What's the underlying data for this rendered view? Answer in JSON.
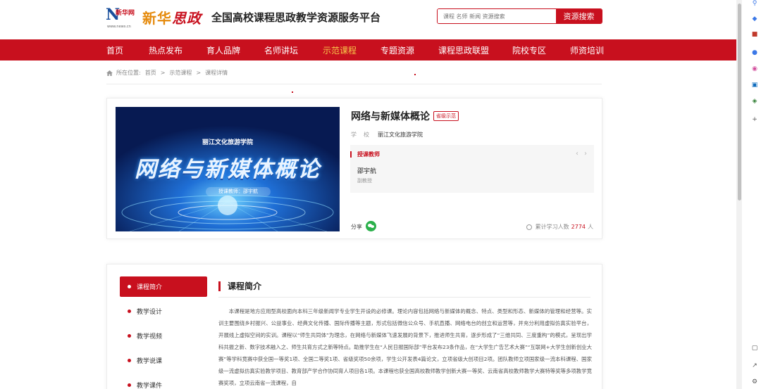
{
  "header": {
    "logo_n": "N",
    "logo_xhw": "新华网",
    "logo_url": "www.news.cn",
    "logo_brand_1": "新华",
    "logo_brand_2": "思政",
    "site_title": "全国高校课程思政教学资源服务平台",
    "search_placeholder": "课程 名师 新闻 资源搜索",
    "search_button": "资源搜索"
  },
  "nav": {
    "items": [
      "首页",
      "热点发布",
      "育人品牌",
      "名师讲坛",
      "示范课程",
      "专题资源",
      "课程思政联盟",
      "院校专区",
      "师资培训"
    ],
    "active": "示范课程"
  },
  "breadcrumb": {
    "prefix": "所在位置:",
    "items": [
      "首页",
      ">",
      "示范课程",
      ">",
      "课程详情"
    ]
  },
  "course": {
    "cover_school": "丽江文化旅游学院",
    "cover_title": "网络与新媒体概论",
    "cover_teacher": "授课教师：邵宇航",
    "title": "网络与新媒体概论",
    "level_badge": "省级示范",
    "school_label": "学校",
    "school_value": "丽江文化旅游学院",
    "teacher_box_title": "授课教师",
    "teacher_name": "邵宇航",
    "teacher_title": "副教授",
    "share_label": "分享",
    "learners_label": "累计学习人数",
    "learners_count": "2774",
    "learners_unit": "人"
  },
  "detail": {
    "menu": [
      "课程简介",
      "教学设计",
      "教学视频",
      "教学说课",
      "教学课件"
    ],
    "active_menu": "课程简介",
    "section_title": "课程简介",
    "section_text": "本课程是地方应用型高校面向本科三年级新闻学专业学生开设的必修课。理论内容包括网络与新媒体的概念、特点、类型和形态、新媒体的管理和经营等。实训主要围绕乡村振兴、公益事业、经典文化传播、国际传播等主题，形式包括微信公众号、手机直播、网络电台的创立和运营等，并充分利用虚拟仿真实验平台，开展线上虚拟空间的实训。课程以“师生共同体”为理念，在网络与新媒体飞速发展的背景下，推进师生共育，逐步形成了“三维共同、三度重构”的模式，呈现出学科共振之新、数字技术融入之、师生共育方式之新等特点。助推学生在“人民日报国际部”平台发布23条作品，在“大学生广告艺术大赛”“互联网+大学生创新创业大赛”等学科竞赛中获全国一等奖1项、全国二等奖1项、省级奖项50余项，学生公开发表4篇论文，立项省级大创项目2项。团队教师立项国家级一流本科课程、国家级一流虚拟仿真实验教学项目、教育部产学合作协同育人项目各1项。本课程也获全国高校教师教学创新大赛一等奖、云南省高校教师教学大赛特等奖等多项教学竞赛奖项，立项云南省一流课程，自"
  },
  "colors": {
    "brand_red": "#c8101e",
    "nav_active": "#f7c84a",
    "brand_orange": "#e58a0c",
    "logo_blue": "#1a4f9c"
  },
  "browser_sidebar_icons": [
    "search-icon",
    "tag-icon",
    "briefcase-icon",
    "people-icon",
    "copilot-icon",
    "outlook-icon",
    "shopping-icon",
    "add-icon",
    "feedback-icon",
    "external-icon",
    "settings-icon"
  ]
}
